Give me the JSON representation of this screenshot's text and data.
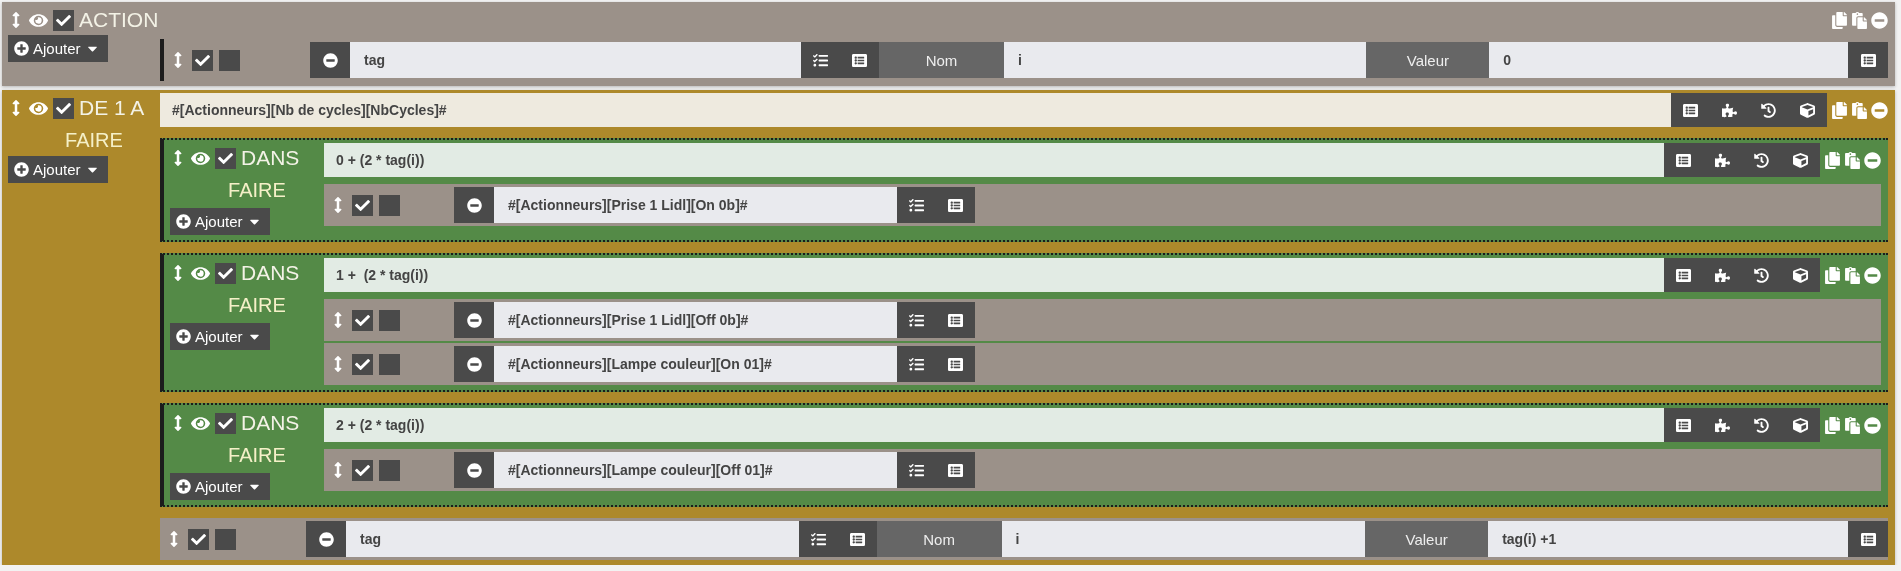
{
  "blocks": [
    {
      "kind": "action",
      "label": "ACTION",
      "enabled": true,
      "add_button": "Ajouter",
      "actions": [
        {
          "kind": "tag",
          "enabled": true,
          "parallel": false,
          "command": "tag",
          "name_label": "Nom",
          "name": "i",
          "value_label": "Valeur",
          "value": "0"
        }
      ]
    },
    {
      "kind": "for",
      "label": "DE 1 A",
      "enabled": true,
      "expression": "#[Actionneurs][Nb de cycles][NbCycles]#",
      "do_label": "FAIRE",
      "add_button": "Ajouter",
      "children": [
        {
          "kind": "in",
          "label": "DANS",
          "enabled": true,
          "expression": "0 + (2 * tag(i))",
          "do_label": "FAIRE",
          "add_button": "Ajouter",
          "actions": [
            {
              "kind": "command",
              "enabled": true,
              "parallel": false,
              "command": "#[Actionneurs][Prise 1 Lidl][On 0b]#"
            }
          ]
        },
        {
          "kind": "in",
          "label": "DANS",
          "enabled": true,
          "expression": "1 +  (2 * tag(i))",
          "do_label": "FAIRE",
          "add_button": "Ajouter",
          "actions": [
            {
              "kind": "command",
              "enabled": true,
              "parallel": false,
              "command": "#[Actionneurs][Prise 1 Lidl][Off 0b]#"
            },
            {
              "kind": "command",
              "enabled": true,
              "parallel": false,
              "command": "#[Actionneurs][Lampe couleur][On 01]#"
            }
          ]
        },
        {
          "kind": "in",
          "label": "DANS",
          "enabled": true,
          "expression": "2 + (2 * tag(i))",
          "do_label": "FAIRE",
          "add_button": "Ajouter",
          "actions": [
            {
              "kind": "command",
              "enabled": true,
              "parallel": false,
              "command": "#[Actionneurs][Lampe couleur][Off 01]#"
            }
          ]
        }
      ],
      "actions": [
        {
          "kind": "tag",
          "enabled": true,
          "parallel": false,
          "command": "tag",
          "name_label": "Nom",
          "name": "i",
          "value_label": "Valeur",
          "value": "tag(i) +1"
        }
      ]
    }
  ]
}
